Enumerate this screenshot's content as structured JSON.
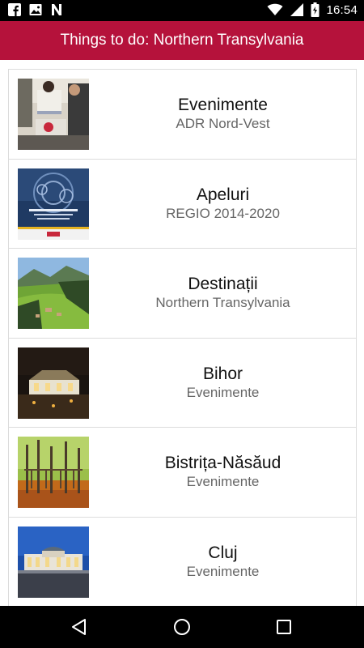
{
  "status_bar": {
    "time": "16:54",
    "left_icons": [
      "facebook-icon",
      "image-icon",
      "n-logo-icon"
    ],
    "right_icons": [
      "wifi-icon",
      "signal-icon",
      "battery-icon"
    ]
  },
  "app_bar": {
    "title": "Things to do: Northern Transylvania",
    "color": "#b5123b"
  },
  "items": [
    {
      "title": "Evenimente",
      "subtitle": "ADR Nord-Vest"
    },
    {
      "title": "Apeluri",
      "subtitle": "REGIO 2014-2020"
    },
    {
      "title": "Destinații",
      "subtitle": "Northern Transylvania"
    },
    {
      "title": "Bihor",
      "subtitle": "Evenimente"
    },
    {
      "title": "Bistrița-Năsăud",
      "subtitle": "Evenimente"
    },
    {
      "title": "Cluj",
      "subtitle": "Evenimente"
    }
  ],
  "nav_bar": {
    "buttons": [
      "back-icon",
      "home-icon",
      "recents-icon"
    ]
  }
}
